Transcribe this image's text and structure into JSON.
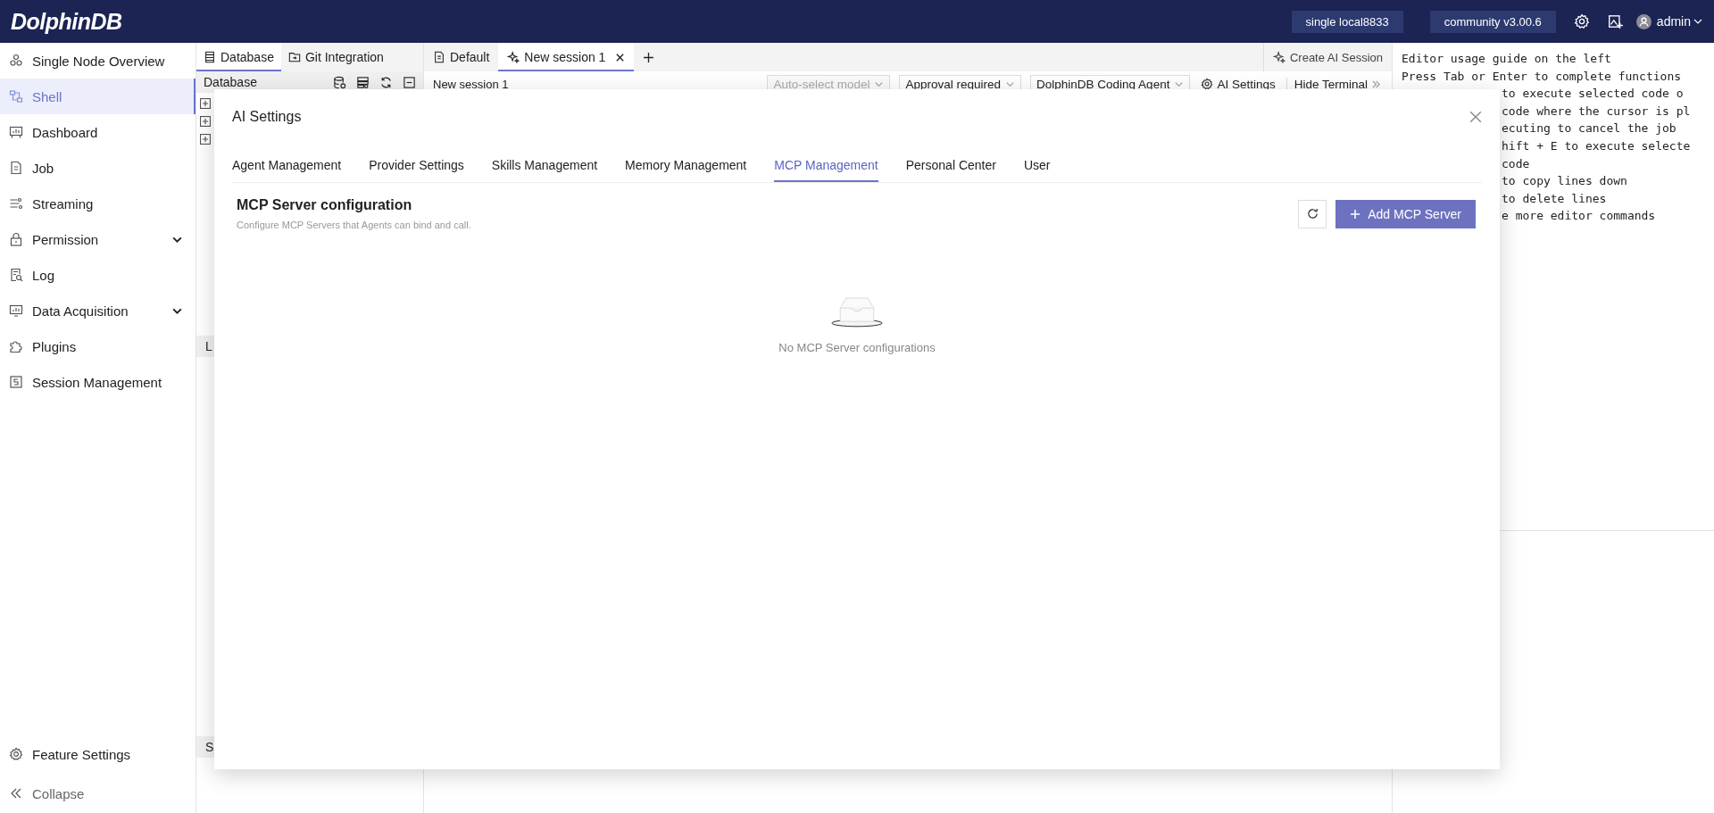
{
  "header": {
    "logo": "DolphinDB",
    "badges": [
      "single local8833",
      "community v3.00.6"
    ],
    "user": "admin"
  },
  "sidebar": {
    "items": [
      {
        "label": "Single Node Overview",
        "selected": false,
        "kind": "link"
      },
      {
        "label": "Shell",
        "selected": true,
        "kind": "link"
      },
      {
        "label": "Dashboard",
        "selected": false,
        "kind": "link"
      },
      {
        "label": "Job",
        "selected": false,
        "kind": "link"
      },
      {
        "label": "Streaming",
        "selected": false,
        "kind": "link"
      },
      {
        "label": "Permission",
        "selected": false,
        "kind": "group",
        "expanded": false
      },
      {
        "label": "Log",
        "selected": false,
        "kind": "link"
      },
      {
        "label": "Data Acquisition",
        "selected": false,
        "kind": "group",
        "expanded": false
      },
      {
        "label": "Plugins",
        "selected": false,
        "kind": "link"
      },
      {
        "label": "Session Management",
        "selected": false,
        "kind": "link"
      }
    ],
    "footer": [
      "Feature Settings",
      "Collapse"
    ]
  },
  "db_panel": {
    "tabs": [
      {
        "label": "Database",
        "selected": true
      },
      {
        "label": "Git Integration",
        "selected": false
      }
    ],
    "header": "Database",
    "sections": [
      "L",
      "S"
    ]
  },
  "editor": {
    "tabs": [
      {
        "label": "Default",
        "kind": "file",
        "selected": false,
        "closable": false
      },
      {
        "label": "New session 1",
        "kind": "ai",
        "selected": true,
        "closable": true
      }
    ],
    "create_button": "Create AI Session",
    "session_title": "New session 1",
    "selects": [
      {
        "label": "Auto-select model",
        "disabled": true
      },
      {
        "label": "Approval required",
        "disabled": false
      },
      {
        "label": "DolphinDB Coding Agent",
        "disabled": false
      }
    ],
    "ai_settings": "AI Settings",
    "hide_terminal": "Hide Terminal"
  },
  "terminal": {
    "lines": [
      "Editor usage guide on the left",
      "Press Tab or Enter to complete functions"
    ],
    "partly_covered_lines": [
      "to execute selected code o",
      "code where the cursor is pl",
      "ecuting to cancel the job",
      "hift + E to execute selecte",
      "code",
      "to copy lines down",
      "to delete lines",
      "e more editor commands"
    ]
  },
  "modal": {
    "title": "AI Settings",
    "tabs": [
      {
        "label": "Agent Management",
        "selected": false
      },
      {
        "label": "Provider Settings",
        "selected": false
      },
      {
        "label": "Skills Management",
        "selected": false
      },
      {
        "label": "Memory Management",
        "selected": false
      },
      {
        "label": "MCP Management",
        "selected": true
      },
      {
        "label": "Personal Center",
        "selected": false
      },
      {
        "label": "User",
        "selected": false
      }
    ],
    "section_title": "MCP Server configuration",
    "description": "Configure MCP Servers that Agents can bind and call.",
    "add_button": "Add MCP Server",
    "empty_text": "No MCP Server configurations"
  }
}
